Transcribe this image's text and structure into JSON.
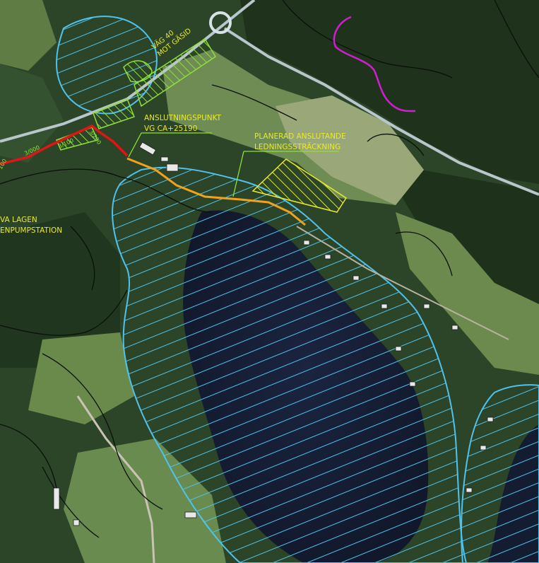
{
  "map": {
    "labels": {
      "road": "VÄG 40",
      "road_direction": "MOT GÄSID",
      "connection_point": "ANSLUTNINGSPUNKT",
      "connection_coord": "VG CA+25190",
      "planned_title": "PLANERAD ANSLUTANDE",
      "planned_subtitle": "LEDNINGSSTRÄCKNING",
      "va_line1": "VA LAGEN",
      "va_line2": "ENPUMPSTATION",
      "chainage_1": "3/000",
      "chainage_2": "3/100",
      "chainage_3": "3/200",
      "chainage_0": "100"
    },
    "colors": {
      "forest": "#23381f",
      "field": "#7d9a62",
      "lake": "#141c31",
      "protection_zone": "#4fc3ee",
      "hatch_green": "#8ee03a",
      "hatch_yellow": "#e8ea2a",
      "pipeline_red": "#e01515",
      "pipeline_orange": "#f2a21a",
      "stream": "#d21ed2",
      "road": "#b9c7cc"
    }
  }
}
